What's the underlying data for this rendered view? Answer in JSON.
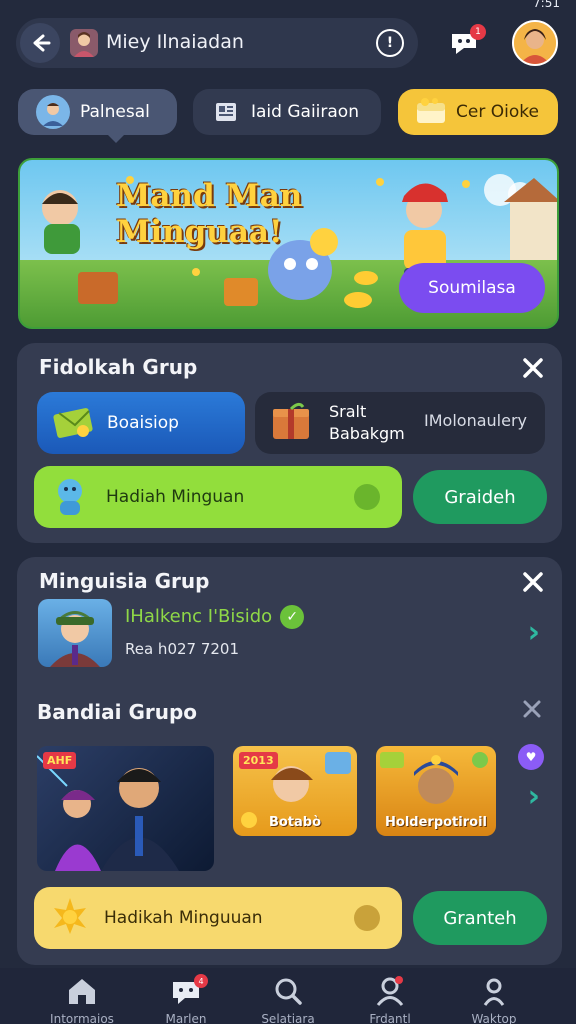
{
  "status_bar": {
    "time": "7:51"
  },
  "header": {
    "title": "Miey Ilnaiadan",
    "notification_badge": "1"
  },
  "chips": [
    {
      "label": "Palnesal"
    },
    {
      "label": "Iaid Gaiiraon"
    },
    {
      "label": "Cer Oioke"
    }
  ],
  "banner": {
    "title_line1": "Mand Man",
    "title_line2": "Minguaa!",
    "button_label": "Soumilasa"
  },
  "card1": {
    "title": "Fidolkah Grup",
    "pill_blue_label": "Boaisiop",
    "pill_dark_line1": "Sralt",
    "pill_dark_line2": "Babakgm",
    "pill_dark_extra": "IMolonaulery",
    "pill_green_label": "Hadiah Minguan",
    "button_label": "Graideh"
  },
  "card2": {
    "title": "Minguisia Grup",
    "member_name": "IHalkenc I'Bisido",
    "member_sub": "Rea h027 7201",
    "section_title": "Bandiai Grupo",
    "thumbs": [
      {
        "tag": "AHF",
        "caption": ""
      },
      {
        "tag": "2013",
        "caption": "Botabò"
      },
      {
        "tag": "",
        "caption": "Holderpotiroil"
      }
    ],
    "pill_yellow_label": "Hadikah Minguuan",
    "button_label": "Granteh"
  },
  "nav": {
    "items": [
      {
        "label": "Intormaios",
        "icon": "home-icon"
      },
      {
        "label": "Marlen",
        "icon": "chat-icon",
        "badge": "4"
      },
      {
        "label": "Selatiara",
        "icon": "search-icon"
      },
      {
        "label": "Frdantl",
        "icon": "user-pin-icon"
      },
      {
        "label": "Waktop",
        "icon": "profile-icon"
      }
    ]
  },
  "colors": {
    "background": "#232a3d",
    "card": "#353c51",
    "accent_green": "#1f9a5f",
    "accent_yellow": "#f5c53a",
    "accent_purple": "#7b4cf0",
    "badge_red": "#e53946"
  }
}
